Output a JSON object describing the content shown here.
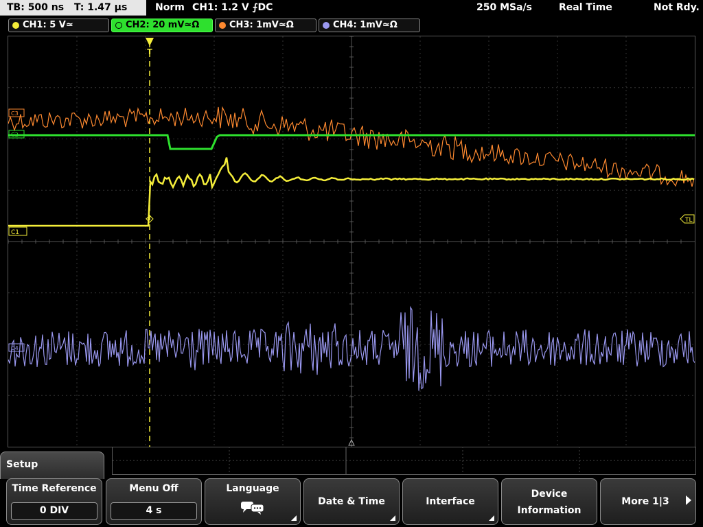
{
  "status": {
    "timebase": "TB: 500 ns",
    "trigger_time": "T: 1.47 µs",
    "mode": "Norm",
    "trigger": "CH1: 1.2 V ⨍DC",
    "sample_rate": "250 MSa/s",
    "acq_mode": "Real Time",
    "state": "Not Rdy."
  },
  "channels": [
    {
      "label": "CH1: 5 V≃",
      "color": "#f5ee3a"
    },
    {
      "label": "CH2: 20 mV≃Ω",
      "color": "#2ee02e"
    },
    {
      "label": "CH3: 1mV≃Ω",
      "color": "#ff8a30"
    },
    {
      "label": "CH4: 1mV≃Ω",
      "color": "#9a98f0"
    }
  ],
  "markers": {
    "trigger_level": "TL",
    "ch1_marker": "C1",
    "ch2_marker": "C2",
    "ch3_marker": "C3",
    "ch4_marker": "C4",
    "trigger_position": "T"
  },
  "menu": {
    "title": "Setup",
    "softkeys": [
      {
        "label": "Time Reference",
        "value": "0 DIV"
      },
      {
        "label": "Menu Off",
        "value": "4 s"
      },
      {
        "label": "Language",
        "icon": "speech-bubbles-icon"
      },
      {
        "label": "Date & Time"
      },
      {
        "label": "Interface"
      },
      {
        "label": "Device",
        "label2": "Information"
      },
      {
        "label": "More 1|3",
        "icon": "right-arrow-icon"
      }
    ]
  }
}
